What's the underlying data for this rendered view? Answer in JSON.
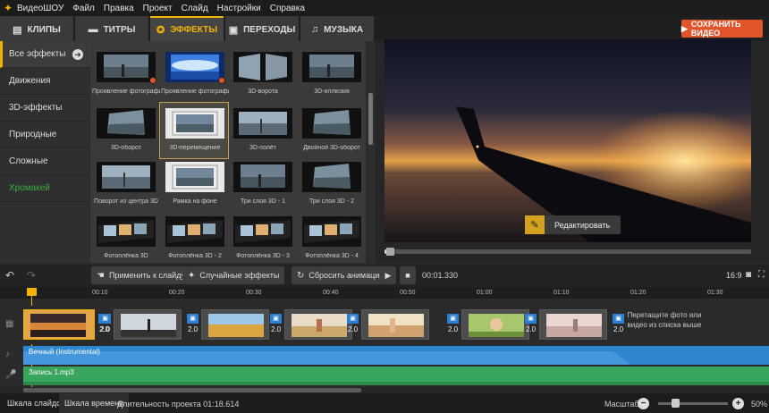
{
  "menubar": {
    "app_name": "ВидеоШОУ",
    "items": [
      "Файл",
      "Правка",
      "Проект",
      "Слайд",
      "Настройки",
      "Справка"
    ]
  },
  "tabs": [
    {
      "label": "КЛИПЫ",
      "icon": "clips-icon",
      "active": false
    },
    {
      "label": "ТИТРЫ",
      "icon": "titles-icon",
      "active": false
    },
    {
      "label": "ЭФФЕКТЫ",
      "icon": "effects-icon",
      "active": true
    },
    {
      "label": "ПЕРЕХОДЫ",
      "icon": "transitions-icon",
      "active": false
    },
    {
      "label": "МУЗЫКА",
      "icon": "music-icon",
      "active": false
    }
  ],
  "save_button": "СОХРАНИТЬ ВИДЕО",
  "sidebar": {
    "items": [
      {
        "label": "Все эффекты",
        "active": true
      },
      {
        "label": "Движения"
      },
      {
        "label": "3D-эффекты"
      },
      {
        "label": "Природные"
      },
      {
        "label": "Сложные"
      },
      {
        "label": "Хромакей",
        "accent": true
      }
    ]
  },
  "effects": [
    {
      "label": "Проявление фотографии...",
      "style": "dark-pier",
      "badge": true
    },
    {
      "label": "Проявление фотографии...",
      "style": "blue-flare",
      "badge": true
    },
    {
      "label": "3D-ворота",
      "style": "gates"
    },
    {
      "label": "3D-иллюзия",
      "style": "dark-pier"
    },
    {
      "label": "3D-оборот",
      "style": "tilted"
    },
    {
      "label": "3D-перемещение",
      "style": "framed",
      "selected": true
    },
    {
      "label": "3D-полёт",
      "style": "pier"
    },
    {
      "label": "Двойной 3D-оборот",
      "style": "tilted"
    },
    {
      "label": "Поворот из центра 3D",
      "style": "pier"
    },
    {
      "label": "Рамка на фоне",
      "style": "framed"
    },
    {
      "label": "Три слоя 3D - 1",
      "style": "dark-pier"
    },
    {
      "label": "Три слоя 3D - 2",
      "style": "tilted"
    },
    {
      "label": "Фотоплёнка 3D",
      "style": "film"
    },
    {
      "label": "Фотоплёнка 3D - 2",
      "style": "film"
    },
    {
      "label": "Фотоплёнка 3D - 3",
      "style": "film"
    },
    {
      "label": "Фотоплёнка 3D - 4",
      "style": "film"
    }
  ],
  "preview": {
    "edit_button": "Редактировать",
    "progress": 0.02
  },
  "toolbar": {
    "apply_button": "Применить к слайду",
    "random_button": "Случайные эффекты",
    "reset_button": "Сбросить анимацию",
    "time": "00:01.330",
    "aspect": "16:9"
  },
  "ruler": {
    "ticks": [
      "00:10",
      "00:20",
      "00:30",
      "00:40",
      "00:50",
      "01:00",
      "01:10",
      "01:20",
      "01:30"
    ]
  },
  "timeline": {
    "clips": [
      "sunset",
      "silhouette",
      "wheat",
      "girl-field",
      "wheat-sun",
      "girl-flowers",
      "blur-field"
    ],
    "transition_value": "2.0",
    "drop_hint": "Перетащите фото или видео из списка выше"
  },
  "audio": {
    "track1": "Вечный (Instrumental)",
    "track2": "Запись 1.mp3"
  },
  "status": {
    "tab_slides": "Шкала слайдов",
    "tab_timeline": "Шкала времени",
    "duration": "Длительность проекта 01:18.614",
    "zoom_label": "Масштаб:",
    "zoom_value": "50%"
  },
  "colors": {
    "accent": "#f0b400",
    "save": "#e2542a",
    "audio_blue": "#2f86d0",
    "audio_green": "#3aa55d",
    "chromakey": "#3fae3f"
  }
}
